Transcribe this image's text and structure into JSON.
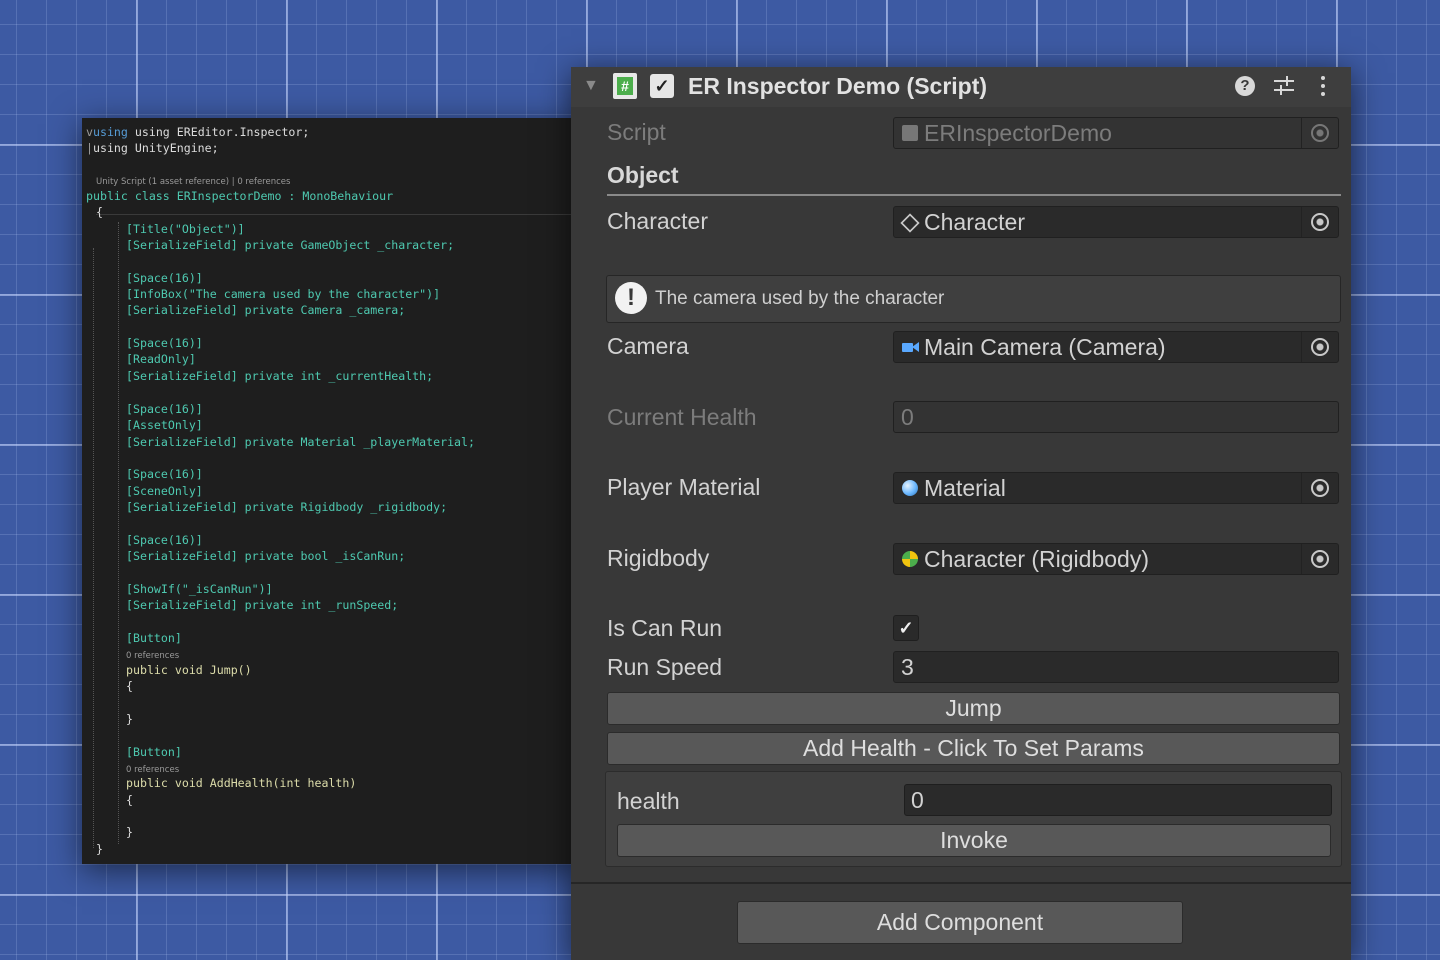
{
  "code": {
    "lines": [
      {
        "t": "using EREditor.Inspector;"
      },
      {
        "t": "using UnityEngine;"
      },
      {
        "t": "Unity Script (1 asset reference) | 0 references"
      },
      {
        "t": "public class ERInspectorDemo : MonoBehaviour"
      },
      {
        "t": "{"
      },
      {
        "t": "[Title(\"Object\")]"
      },
      {
        "t": "[SerializeField] private GameObject _character;"
      },
      {
        "t": "[Space(16)]"
      },
      {
        "t": "[InfoBox(\"The camera used by the character\")]"
      },
      {
        "t": "[SerializeField] private Camera _camera;"
      },
      {
        "t": "[Space(16)]"
      },
      {
        "t": "[ReadOnly]"
      },
      {
        "t": "[SerializeField] private int _currentHealth;"
      },
      {
        "t": "[Space(16)]"
      },
      {
        "t": "[AssetOnly]"
      },
      {
        "t": "[SerializeField] private Material _playerMaterial;"
      },
      {
        "t": "[Space(16)]"
      },
      {
        "t": "[SceneOnly]"
      },
      {
        "t": "[SerializeField] private Rigidbody _rigidbody;"
      },
      {
        "t": "[Space(16)]"
      },
      {
        "t": "[SerializeField] private bool _isCanRun;"
      },
      {
        "t": "[ShowIf(\"_isCanRun\")]"
      },
      {
        "t": "[SerializeField] private int _runSpeed;"
      },
      {
        "t": "[Button]"
      },
      {
        "t": "0 references"
      },
      {
        "t": "public void Jump()"
      },
      {
        "t": "{"
      },
      {
        "t": "}"
      },
      {
        "t": "[Button]"
      },
      {
        "t": "0 references"
      },
      {
        "t": "public void AddHealth(int health)"
      },
      {
        "t": "{"
      },
      {
        "t": "}"
      },
      {
        "t": "}"
      }
    ]
  },
  "inspector": {
    "title": "ER Inspector Demo (Script)",
    "script_label": "Script",
    "script_value": "ERInspectorDemo",
    "section_title": "Object",
    "character_label": "Character",
    "character_value": "Character",
    "infobox_text": "The camera used by the character",
    "camera_label": "Camera",
    "camera_value": "Main Camera (Camera)",
    "current_health_label": "Current Health",
    "current_health_value": "0",
    "player_material_label": "Player Material",
    "player_material_value": "Material",
    "rigidbody_label": "Rigidbody",
    "rigidbody_value": "Character (Rigidbody)",
    "is_can_run_label": "Is Can Run",
    "is_can_run_checked": true,
    "run_speed_label": "Run Speed",
    "run_speed_value": "3",
    "jump_button": "Jump",
    "add_health_button": "Add Health - Click To Set Params",
    "param_label": "health",
    "param_value": "0",
    "invoke_button": "Invoke",
    "add_component_button": "Add Component"
  },
  "colors": {
    "background": "#3d5aa3",
    "inspector_bg": "#383838",
    "code_bg": "#1e1e1e",
    "script_icon": "#4cae4c",
    "camera_icon": "#5aa9ff",
    "material_icon": "#6ab7ff"
  },
  "icons": [
    "fold-arrow-icon",
    "script-hash-icon",
    "enabled-check-icon",
    "help-icon",
    "preset-icon",
    "kebab-menu-icon",
    "object-picker-icon",
    "gameobject-cube-icon",
    "camera-icon",
    "material-sphere-icon",
    "rigidbody-icon",
    "warning-icon",
    "checkbox-check-icon"
  ]
}
